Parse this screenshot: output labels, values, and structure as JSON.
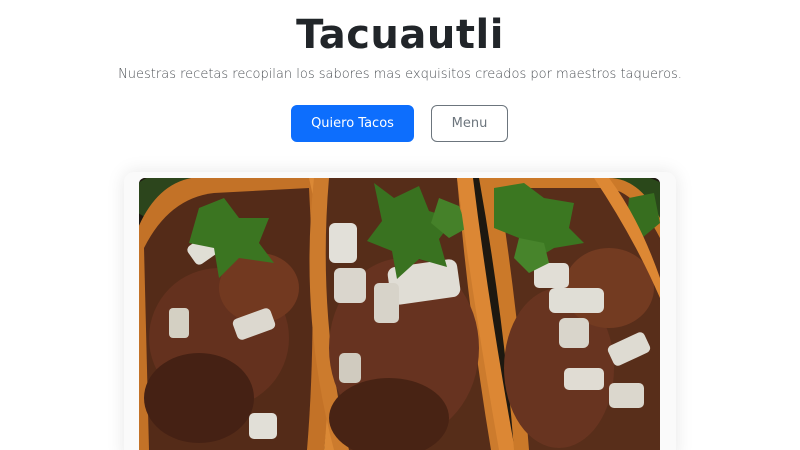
{
  "hero": {
    "title": "Tacuautli",
    "lead": "Nuestras recetas recopilan los sabores mas exquisitos creados por maestros taqueros.",
    "primary_button": "Quiero Tacos",
    "secondary_button": "Menu"
  },
  "image": {
    "subject": "three street tacos with shredded meat, diced onion and cilantro",
    "icon": "tacos-photo"
  },
  "colors": {
    "primary": "#0d6efd",
    "secondary": "#6c757d",
    "text": "#212529"
  }
}
